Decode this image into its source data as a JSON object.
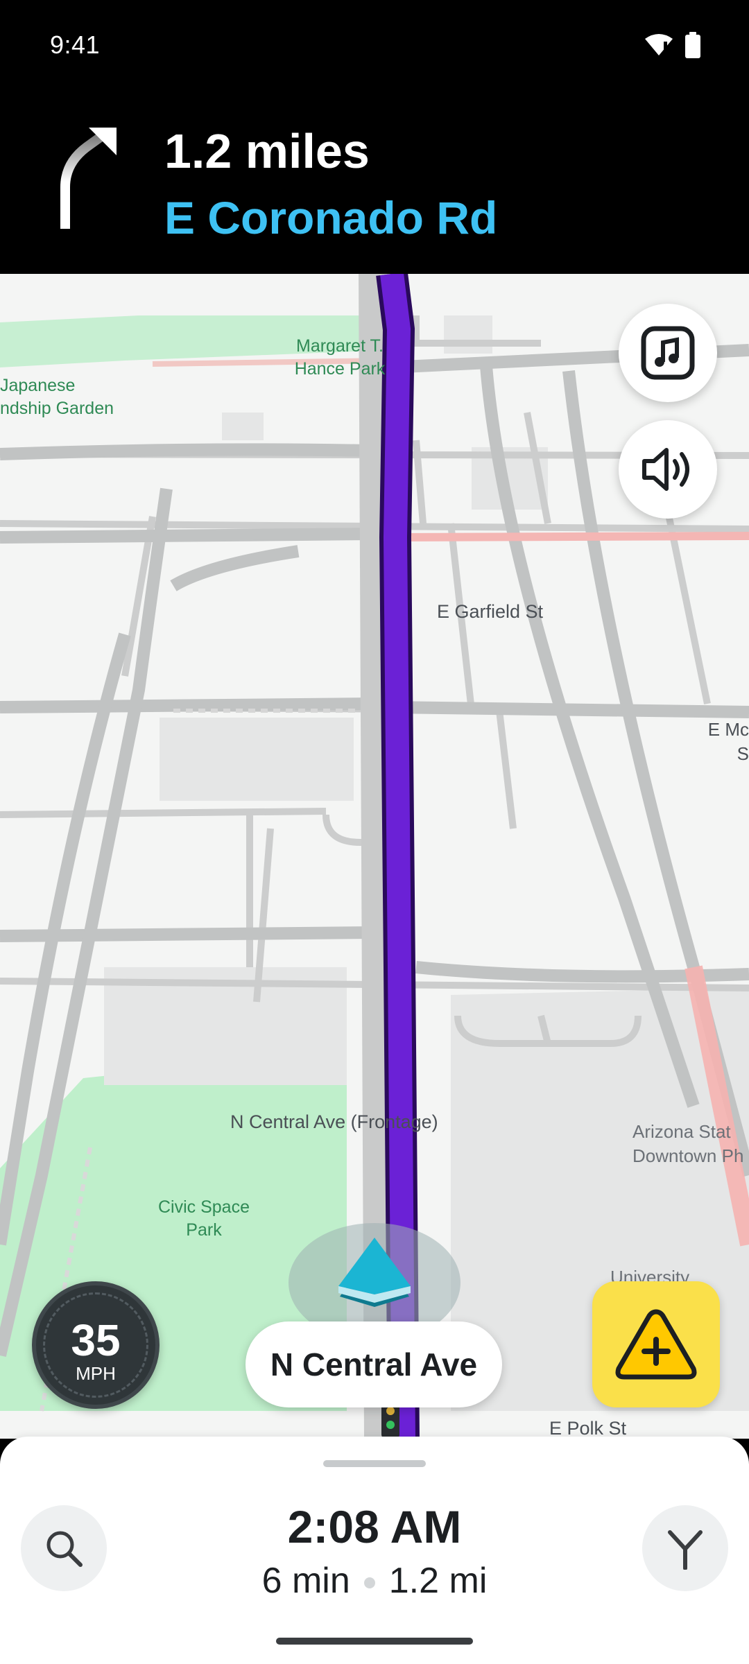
{
  "status_bar": {
    "time": "9:41",
    "icons": [
      "wifi-icon",
      "battery-icon"
    ]
  },
  "navigation": {
    "distance": "1.2 miles",
    "next_street": "E Coronado Rd",
    "turn_icon": "turn-slight-right-icon"
  },
  "map": {
    "labels": {
      "park_1": "Margaret T. Hance Park",
      "garden": "Japanese\nndship Garden",
      "garfield": "E Garfield St",
      "e_mc": "E Mc\nS",
      "frontage": "N Central Ave (Frontage)",
      "civic": "Civic Space Park",
      "asu": "Arizona Stat\nDowntown Ph",
      "university": "University",
      "polk": "E Polk St"
    },
    "colors": {
      "route": "#6B21D6",
      "vehicle": "#1BB5D3",
      "park": "#BDEFC9"
    }
  },
  "controls": {
    "music_icon": "music-icon",
    "sound_icon": "speaker-icon",
    "report_icon": "report-hazard-icon"
  },
  "speed": {
    "value": "35",
    "unit": "MPH"
  },
  "current_street": "N Central Ave",
  "trip": {
    "eta": "2:08 AM",
    "duration": "6 min",
    "distance": "1.2 mi"
  }
}
